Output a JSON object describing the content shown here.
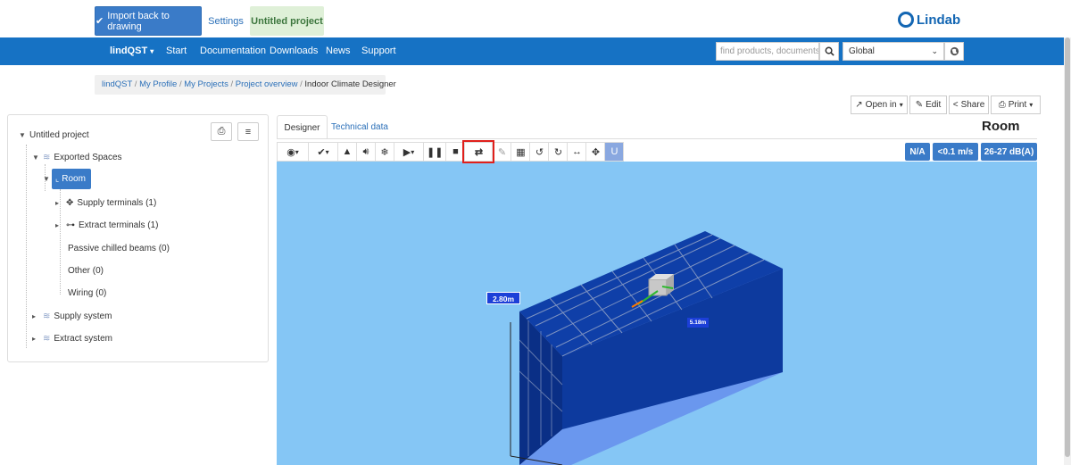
{
  "topbar": {
    "import_label": "Import back to drawing",
    "settings_label": "Settings",
    "project_label": "Untitled project",
    "logo_text": "Lindab"
  },
  "nav": {
    "brand": "lindQST",
    "items": [
      "Start",
      "Documentation",
      "Downloads",
      "News",
      "Support"
    ],
    "search_placeholder": "find products, documents et",
    "region": "Global"
  },
  "breadcrumb": {
    "links": [
      "lindQST",
      "My Profile",
      "My Projects",
      "Project overview"
    ],
    "current": "Indoor Climate Designer"
  },
  "actions": {
    "open_in": "Open in",
    "edit": "Edit",
    "share": "Share",
    "print": "Print"
  },
  "tree": {
    "root": "Untitled project",
    "exported_spaces": "Exported Spaces",
    "room": "Room",
    "supply_terminals": "Supply terminals (1)",
    "extract_terminals": "Extract terminals (1)",
    "passive_beams": "Passive chilled beams (0)",
    "other": "Other (0)",
    "wiring": "Wiring (0)",
    "supply_system": "Supply system",
    "extract_system": "Extract system"
  },
  "tabs": {
    "designer": "Designer",
    "technical": "Technical data"
  },
  "room_title": "Room",
  "badges": {
    "status": "N/A",
    "velocity": "<0.1 m/s",
    "sound": "26-27 dB(A)"
  },
  "viewport": {
    "height_label": "2.80m",
    "width_label": "5.18m"
  },
  "colors": {
    "primary": "#1672c4",
    "accent": "#3a7bc8",
    "viewport_bg": "#85c6f5",
    "room_wall": "#0d3a9e",
    "room_floor": "#6a97ee",
    "highlight": "#e0201c"
  }
}
